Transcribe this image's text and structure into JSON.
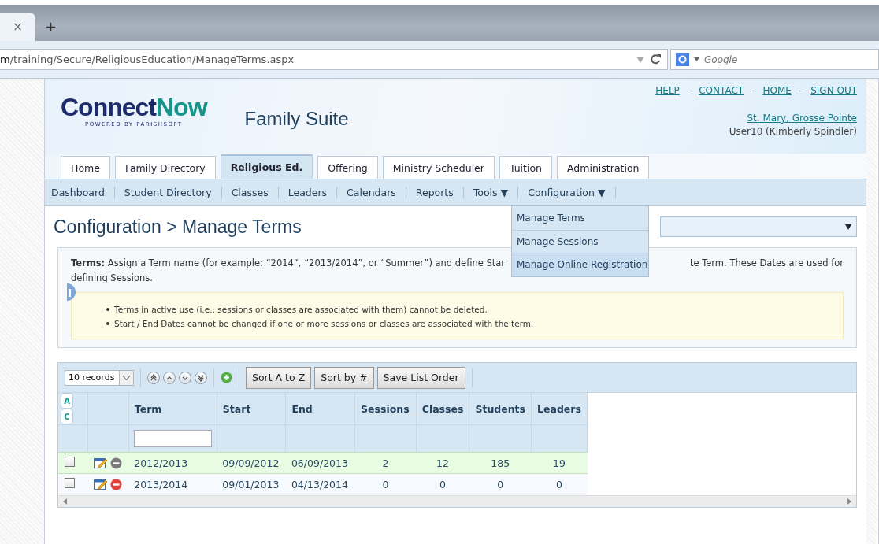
{
  "browser": {
    "url_host_tail": "m",
    "url_path": "/training/Secure/ReligiousEducation/ManageTerms.aspx",
    "search_placeholder": "Google",
    "close_tab": "×",
    "new_tab": "+"
  },
  "header": {
    "logo_dark": "Connect",
    "logo_teal": "Now",
    "logo_tagline": "POWERED BY PARISHSOFT",
    "suite_title": "Family Suite",
    "top_links": [
      "HELP",
      "CONTACT",
      "HOME",
      "SIGN OUT"
    ],
    "link_separator": "-",
    "parish": "St. Mary, Grosse Pointe",
    "user": "User10 (Kimberly Spindler)"
  },
  "tabs": [
    {
      "label": "Home",
      "selected": false
    },
    {
      "label": "Family Directory",
      "selected": false
    },
    {
      "label": "Religious Ed.",
      "selected": true
    },
    {
      "label": "Offering",
      "selected": false
    },
    {
      "label": "Ministry Scheduler",
      "selected": false
    },
    {
      "label": "Tuition",
      "selected": false
    },
    {
      "label": "Administration",
      "selected": false
    }
  ],
  "subnav": [
    "Dashboard",
    "Student Directory",
    "Classes",
    "Leaders",
    "Calendars",
    "Reports",
    "Tools ▼",
    "Configuration ▼"
  ],
  "dropdown_menu": [
    {
      "label": "Manage Terms",
      "selected": false
    },
    {
      "label": "Manage Sessions",
      "selected": false
    },
    {
      "label": "Manage Online Registration",
      "selected": true
    }
  ],
  "page_title": "Configuration > Manage Terms",
  "description_before": "**Terms:** Assign a Term name (for example: “2014”, “2013/2014”, or “Summer”) and define Star",
  "description_after": [
    "te Term. These Dates are used for",
    "defining Sessions."
  ],
  "notes": [
    "Terms in active use (i.e.: sessions or classes are associated with them) cannot be deleted.",
    "Start / End Dates cannot be changed if one or more sessions or classes are associated with the term."
  ],
  "grid": {
    "page_size": "10 records",
    "buttons": [
      "Sort A to Z",
      "Sort by #",
      "Save List Order"
    ],
    "filter_buttons": [
      "A",
      "C"
    ],
    "columns": [
      "Term",
      "Start",
      "End",
      "Sessions",
      "Classes",
      "Students",
      "Leaders"
    ],
    "rows": [
      {
        "checked": false,
        "selected": true,
        "deletable": false,
        "cells": [
          "2012/2013",
          "09/09/2012",
          "06/09/2013",
          "2",
          "12",
          "185",
          "19"
        ]
      },
      {
        "checked": false,
        "selected": false,
        "deletable": true,
        "cells": [
          "2013/2014",
          "09/01/2013",
          "04/13/2014",
          "0",
          "0",
          "0",
          "0"
        ]
      }
    ]
  }
}
